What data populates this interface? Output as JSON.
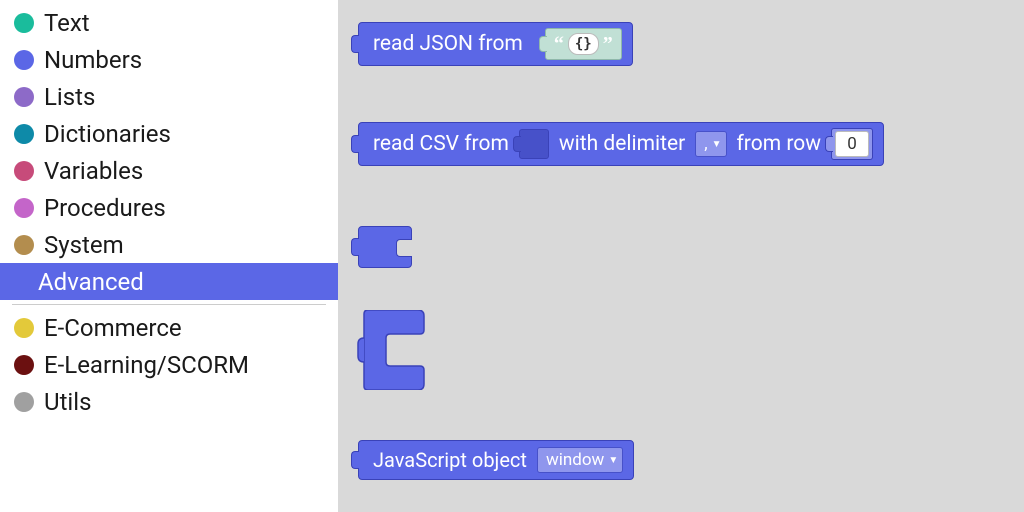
{
  "sidebar": {
    "categories": [
      {
        "label": "Text",
        "color": "#1abc9c"
      },
      {
        "label": "Numbers",
        "color": "#5b67e6"
      },
      {
        "label": "Lists",
        "color": "#8d6ac8"
      },
      {
        "label": "Dictionaries",
        "color": "#0e8aa8"
      },
      {
        "label": "Variables",
        "color": "#c74b7a"
      },
      {
        "label": "Procedures",
        "color": "#c465c9"
      },
      {
        "label": "System",
        "color": "#b38d4e"
      },
      {
        "label": "Advanced",
        "color": "#5b67e6",
        "selected": true
      }
    ],
    "extra_categories": [
      {
        "label": "E-Commerce",
        "color": "#e3c93a"
      },
      {
        "label": "E-Learning/SCORM",
        "color": "#6b1010"
      },
      {
        "label": "Utils",
        "color": "#a0a0a0"
      }
    ]
  },
  "blocks": {
    "read_json": {
      "label": "read JSON from",
      "value": "{}"
    },
    "read_csv": {
      "label1": "read CSV from",
      "label2": "with delimiter",
      "delim": ",",
      "label3": "from row",
      "row": "0"
    },
    "js_object": {
      "label": "JavaScript object",
      "option": "window"
    }
  }
}
